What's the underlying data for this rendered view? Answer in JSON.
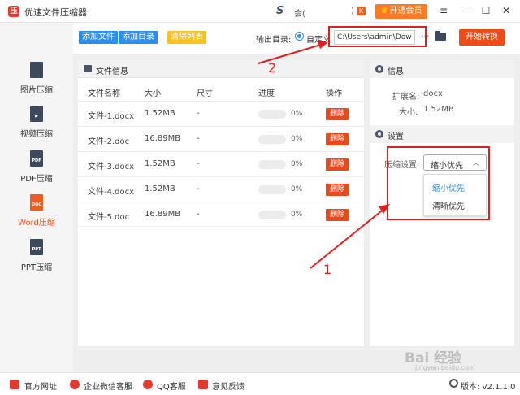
{
  "titlebar": {
    "app_title": "优速文件压缩器",
    "user_name": "会(",
    "user_bracket": ")",
    "vip_label": "开通会员",
    "window_controls": [
      "≡",
      "—",
      "☐",
      "✕"
    ]
  },
  "sidebar": {
    "items": [
      {
        "label": "图片压缩",
        "icon_text": "",
        "icon": "image-icon",
        "active": false
      },
      {
        "label": "视频压缩",
        "icon_text": "▶",
        "icon": "video-icon",
        "active": false
      },
      {
        "label": "PDF压缩",
        "icon_text": "PDF",
        "icon": "pdf-icon",
        "active": false
      },
      {
        "label": "Word压缩",
        "icon_text": "DOC",
        "icon": "doc-icon",
        "active": true
      },
      {
        "label": "PPT压缩",
        "icon_text": "PPT",
        "icon": "ppt-icon",
        "active": false
      }
    ]
  },
  "toolbar": {
    "add_file": "添加文件",
    "add_dir": "添加目录",
    "clear_list": "清除列表",
    "output_label": "输出目录:",
    "custom_label": "自定义",
    "output_path": "C:\\Users\\admin\\Downk",
    "dots": "···",
    "start": "开始转换"
  },
  "file_panel": {
    "title": "文件信息",
    "columns": [
      "文件名称",
      "大小",
      "尺寸",
      "进度",
      "操作"
    ],
    "rows": [
      {
        "name": "文件-1.docx",
        "size": "1.52MB",
        "dim": "-",
        "progress": "0%",
        "action": "删除"
      },
      {
        "name": "文件-2.doc",
        "size": "16.89MB",
        "dim": "-",
        "progress": "0%",
        "action": "删除"
      },
      {
        "name": "文件-3.docx",
        "size": "1.52MB",
        "dim": "-",
        "progress": "0%",
        "action": "删除"
      },
      {
        "name": "文件-4.docx",
        "size": "1.52MB",
        "dim": "-",
        "progress": "0%",
        "action": "删除"
      },
      {
        "name": "文件-5.doc",
        "size": "16.89MB",
        "dim": "-",
        "progress": "0%",
        "action": "删除"
      }
    ]
  },
  "info_panel": {
    "title": "信息",
    "ext_label": "扩展名:",
    "ext_value": "docx",
    "size_label": "大小:",
    "size_value": "1.52MB",
    "settings_title": "设置",
    "compress_label": "压缩设置:",
    "compress_value": "缩小优先",
    "options": [
      "缩小优先",
      "清晰优先"
    ]
  },
  "annotations": {
    "num1": "1",
    "num2": "2"
  },
  "footer": {
    "links": [
      "官方网址",
      "企业微信客服",
      "QQ客服",
      "意见反馈"
    ],
    "version": "版本: v2.1.1.0",
    "watermark": "Bai 经验",
    "watermark_url": "jingyan.baidu.com"
  },
  "colors": {
    "accent": "#f04b16",
    "blue": "#2d8cf0",
    "yellow": "#f5c31a",
    "annotation": "#e21d1d"
  }
}
